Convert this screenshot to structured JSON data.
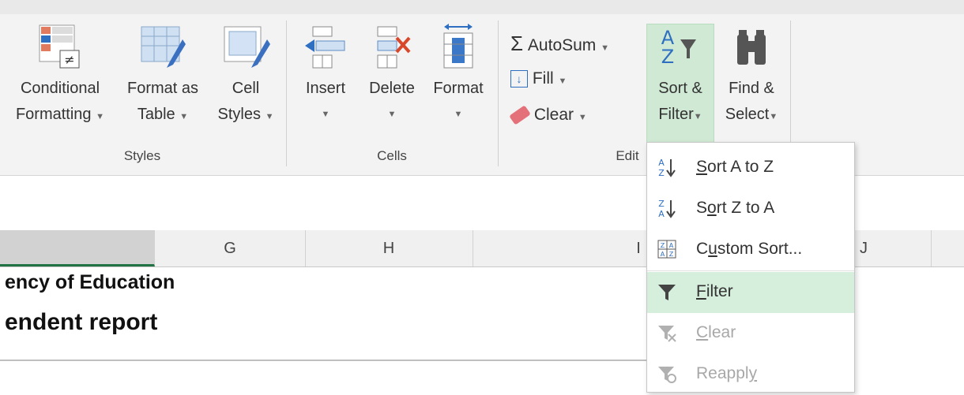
{
  "ribbon": {
    "styles_group": {
      "label": "Styles",
      "buttons": [
        {
          "line1": "Conditional",
          "line2": "Formatting",
          "icon": "conditional-formatting-icon"
        },
        {
          "line1": "Format as",
          "line2": "Table",
          "icon": "format-as-table-icon"
        },
        {
          "line1": "Cell",
          "line2": "Styles",
          "icon": "cell-styles-icon"
        }
      ]
    },
    "cells_group": {
      "label": "Cells",
      "buttons": [
        {
          "line1": "Insert",
          "icon": "insert-cells-icon"
        },
        {
          "line1": "Delete",
          "icon": "delete-cells-icon"
        },
        {
          "line1": "Format",
          "icon": "format-cells-icon"
        }
      ]
    },
    "editing_group": {
      "label": "Edit",
      "autosum": "AutoSum",
      "fill": "Fill",
      "clear": "Clear",
      "sort_filter": {
        "line1": "Sort &",
        "line2": "Filter"
      },
      "find_select": {
        "line1": "Find &",
        "line2": "Select"
      }
    }
  },
  "columns": [
    "G",
    "H",
    "I",
    "J"
  ],
  "sheet": {
    "row1": "ency of Education",
    "row2": "endent report"
  },
  "menu": {
    "items": [
      {
        "label": "Sort A to Z",
        "ul": "S",
        "rest": "ort A to Z",
        "icon": "sort-a-to-z-icon",
        "enabled": true
      },
      {
        "label": "Sort Z to A",
        "pre": "S",
        "ul": "o",
        "rest": "rt Z to A",
        "icon": "sort-z-to-a-icon",
        "enabled": true
      },
      {
        "label": "Custom Sort...",
        "pre": "C",
        "ul": "u",
        "rest": "stom Sort...",
        "icon": "custom-sort-icon",
        "enabled": true
      },
      {
        "label": "Filter",
        "ul": "F",
        "rest": "ilter",
        "icon": "filter-icon",
        "enabled": true,
        "highlighted": true
      },
      {
        "label": "Clear",
        "ul": "C",
        "rest": "lear",
        "icon": "clear-filter-icon",
        "enabled": false
      },
      {
        "label": "Reapply",
        "pre": "Reappl",
        "ul": "y",
        "icon": "reapply-icon",
        "enabled": false
      }
    ]
  },
  "colors": {
    "accent": "#217346",
    "sort_highlight": "#cfe9d4",
    "menu_highlight": "#d6eedc"
  }
}
